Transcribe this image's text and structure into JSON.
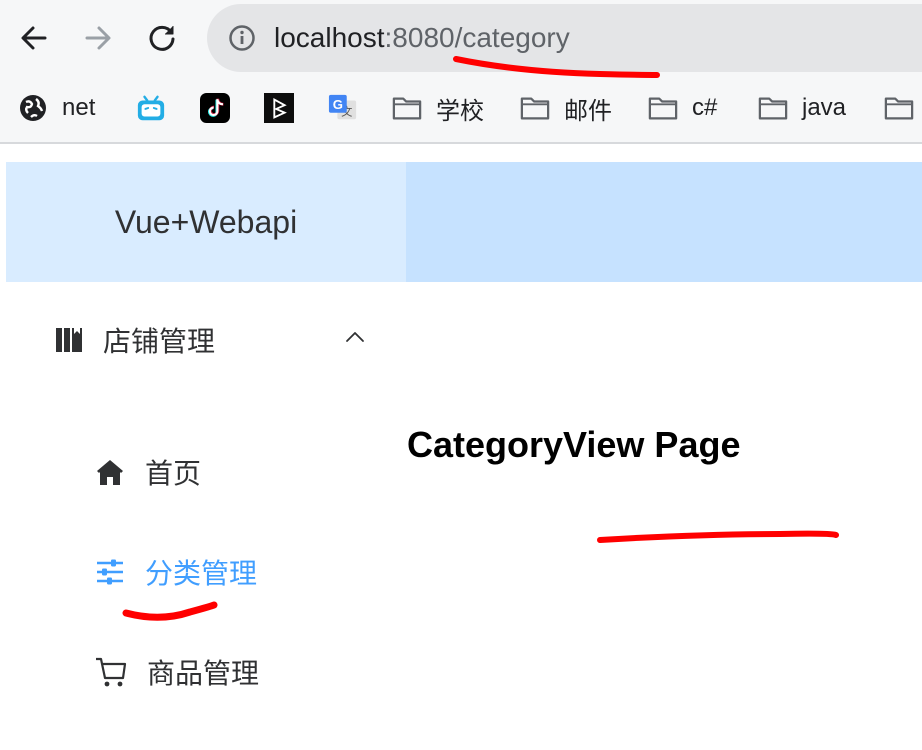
{
  "browser": {
    "url_host": "localhost",
    "url_rest": ":8080/category",
    "bookmarks": [
      {
        "icon": "globe-icon",
        "label": "net"
      },
      {
        "icon": "bilibili-icon",
        "label": ""
      },
      {
        "icon": "tiktok-icon",
        "label": ""
      },
      {
        "icon": "dark-app-icon",
        "label": ""
      },
      {
        "icon": "google-translate-icon",
        "label": ""
      },
      {
        "icon": "folder-icon",
        "label": "学校"
      },
      {
        "icon": "folder-icon",
        "label": "邮件"
      },
      {
        "icon": "folder-icon",
        "label": "c#"
      },
      {
        "icon": "folder-icon",
        "label": "java"
      },
      {
        "icon": "folder-icon",
        "label": ""
      }
    ]
  },
  "app": {
    "brand": "Vue+Webapi",
    "menu": {
      "submenu_title": "店铺管理",
      "items": [
        {
          "label": "首页",
          "icon": "home-icon",
          "active": false
        },
        {
          "label": "分类管理",
          "icon": "sliders-icon",
          "active": true
        },
        {
          "label": "商品管理",
          "icon": "cart-icon",
          "active": false
        }
      ]
    },
    "page_heading": "CategoryView Page"
  },
  "colors": {
    "header_left": "#d9ecff",
    "header_right": "#c6e2ff",
    "active_menu": "#409eff",
    "annotation": "#ff0000"
  }
}
